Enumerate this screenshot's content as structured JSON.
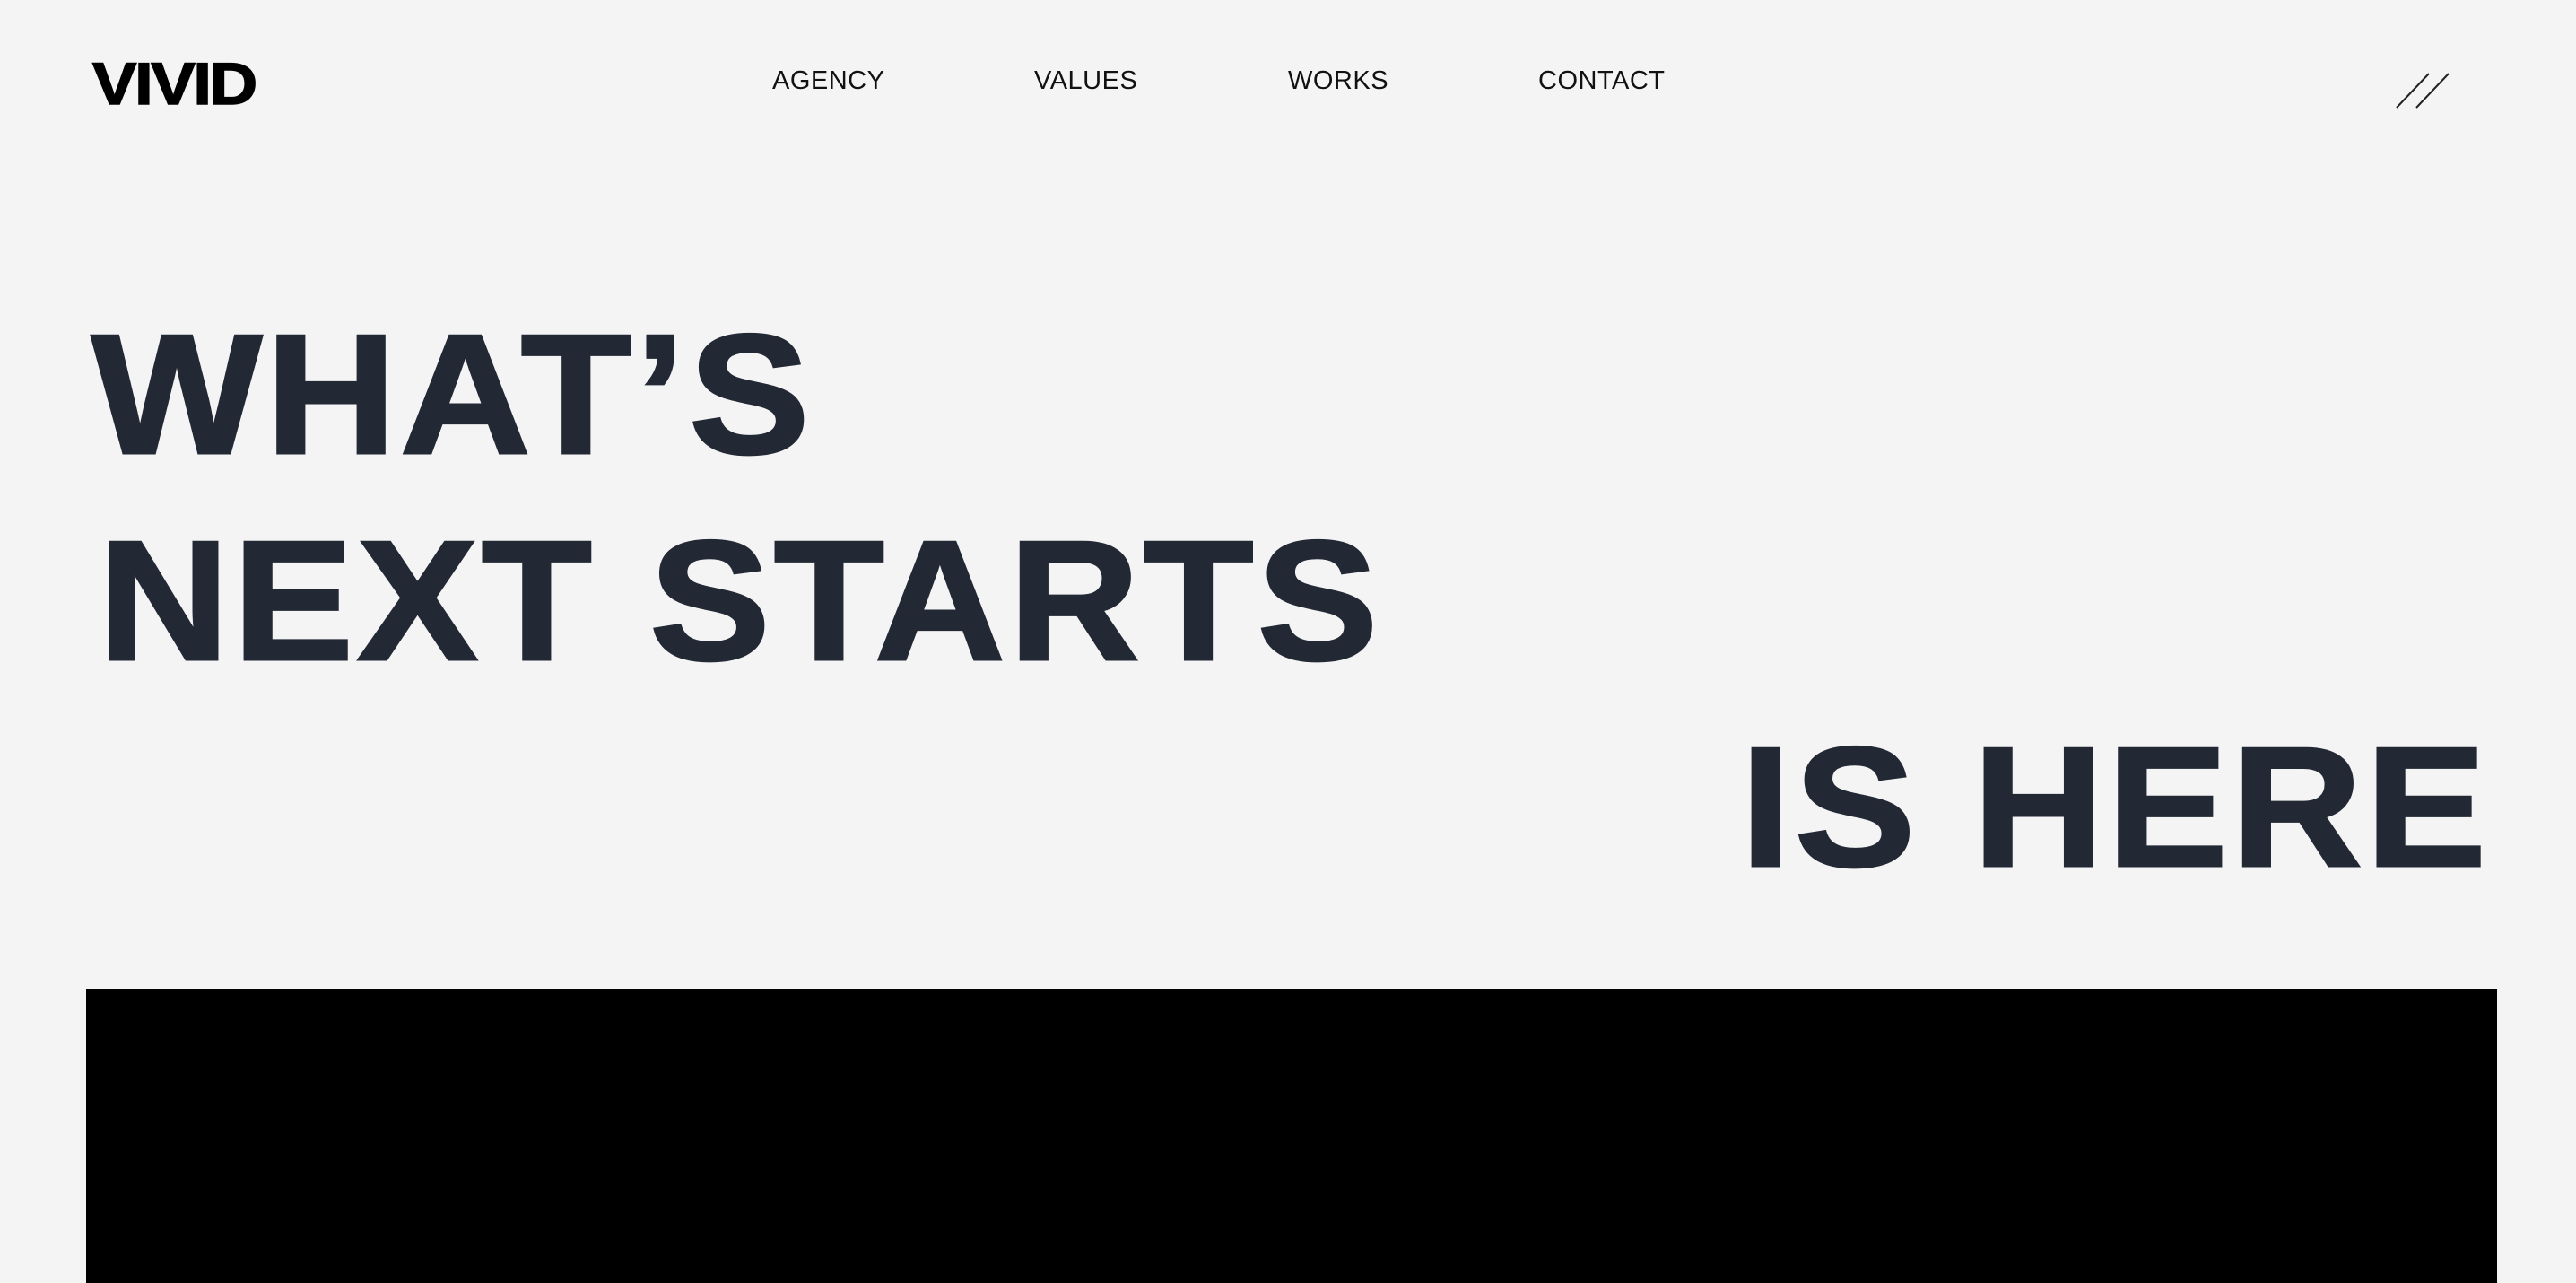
{
  "brand": {
    "logo_text": "VIVID"
  },
  "nav": {
    "items": [
      {
        "label": "AGENCY"
      },
      {
        "label": "VALUES"
      },
      {
        "label": "WORKS"
      },
      {
        "label": "CONTACT"
      }
    ]
  },
  "menu_toggle": {
    "icon": "double-slash-icon"
  },
  "hero": {
    "lines": [
      "WHAT’S",
      "NEXT STARTS",
      "IS HERE"
    ]
  },
  "colors": {
    "background": "#f4f4f4",
    "headline": "#222834",
    "text": "#000000",
    "media_block": "#000000"
  }
}
